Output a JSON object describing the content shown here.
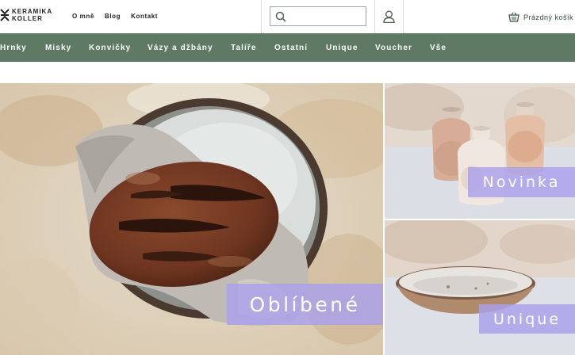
{
  "brand": {
    "line1": "KERAMIKA",
    "line2": "KOLLER"
  },
  "top_links": [
    "O mně",
    "Blog",
    "Kontakt"
  ],
  "search": {
    "placeholder": "",
    "value": ""
  },
  "cart": {
    "label": "Prázdný košík"
  },
  "nav": [
    "Hrnky",
    "Misky",
    "Konvičky",
    "Vázy a džbány",
    "Talíře",
    "Ostatní",
    "Unique",
    "Voucher",
    "Vše"
  ],
  "hero": {
    "main_badge": "Oblíbené",
    "top_right_badge": "Novinka",
    "bottom_right_badge": "Unique"
  },
  "colors": {
    "nav_bg": "#5e7a64",
    "badge_bg": "#aaa0eb",
    "accent_text": "#2e4a3a"
  },
  "icons": [
    "logo-mark-icon",
    "search-icon",
    "user-icon",
    "basket-icon"
  ]
}
